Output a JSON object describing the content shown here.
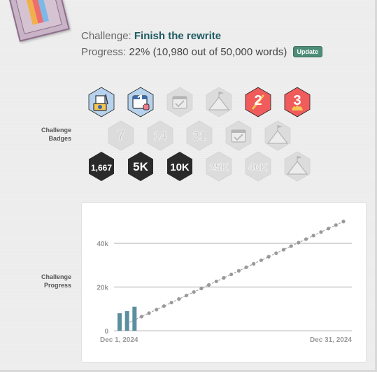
{
  "challenge": {
    "label": "Challenge:",
    "name": "Finish the rewrite"
  },
  "progress": {
    "label": "Progress:",
    "text": "22% (10,980 out of 50,000 words)",
    "percent": 22,
    "update_label": "Update"
  },
  "badges_section": {
    "label_line1": "Challenge",
    "label_line2": "Badges"
  },
  "progress_section": {
    "label_line1": "Challenge",
    "label_line2": "Progress"
  },
  "badges": [
    {
      "name": "writing-on-device",
      "earned": true,
      "bg": "#b7d2ec",
      "icon": "laptop-icon"
    },
    {
      "name": "calendar-one",
      "earned": true,
      "bg": "#b7d2ec",
      "icon": "calendar-icon",
      "text": "1"
    },
    {
      "name": "calendar-check",
      "earned": false,
      "bg": "#dcdcdc",
      "icon": "calendar-check-icon"
    },
    {
      "name": "mountain-flag",
      "earned": false,
      "bg": "#dcdcdc",
      "icon": "mountain-flag-icon"
    },
    {
      "name": "streak-2",
      "earned": true,
      "bg": "#f05b5b",
      "icon": "pencil-icon",
      "text": "2"
    },
    {
      "name": "streak-3",
      "earned": true,
      "bg": "#f05b5b",
      "icon": "flame-icon",
      "text": "3"
    },
    {
      "name": "streak-7",
      "earned": false,
      "bg": "#dcdcdc",
      "text": "7"
    },
    {
      "name": "streak-14",
      "earned": false,
      "bg": "#dcdcdc",
      "text": "14"
    },
    {
      "name": "streak-21",
      "earned": false,
      "bg": "#dcdcdc",
      "text": "21"
    },
    {
      "name": "calendar-check-2",
      "earned": false,
      "bg": "#dcdcdc",
      "icon": "calendar-check-icon"
    },
    {
      "name": "mountain-flag-2",
      "earned": false,
      "bg": "#dcdcdc",
      "icon": "mountain-flag-icon"
    },
    {
      "name": "words-1667",
      "earned": true,
      "bg": "#2a2a2a",
      "text": "1,667"
    },
    {
      "name": "words-5k",
      "earned": true,
      "bg": "#2a2a2a",
      "text": "5K"
    },
    {
      "name": "words-10k",
      "earned": true,
      "bg": "#2a2a2a",
      "text": "10K"
    },
    {
      "name": "words-25k",
      "earned": false,
      "bg": "#dcdcdc",
      "text": "25K"
    },
    {
      "name": "words-40k",
      "earned": false,
      "bg": "#dcdcdc",
      "text": "40K"
    },
    {
      "name": "words-50k-peak",
      "earned": false,
      "bg": "#dcdcdc",
      "icon": "mountain-flag-icon"
    }
  ],
  "chart_data": {
    "type": "bar",
    "x_start_label": "Dec 1, 2024",
    "x_end_label": "Dec 31, 2024",
    "y_ticks": [
      0,
      20000,
      40000
    ],
    "y_tick_labels": [
      "0",
      "20k",
      "40k"
    ],
    "ylim": [
      0,
      50000
    ],
    "days": 31,
    "bars": [
      {
        "day": 1,
        "value": 8000
      },
      {
        "day": 2,
        "value": 9000
      },
      {
        "day": 3,
        "value": 10980
      }
    ],
    "target_total": 50000,
    "colors": {
      "bar": "#5b8fa0",
      "target_line": "#aaaaaa",
      "grid": "#bdbdbd"
    }
  }
}
